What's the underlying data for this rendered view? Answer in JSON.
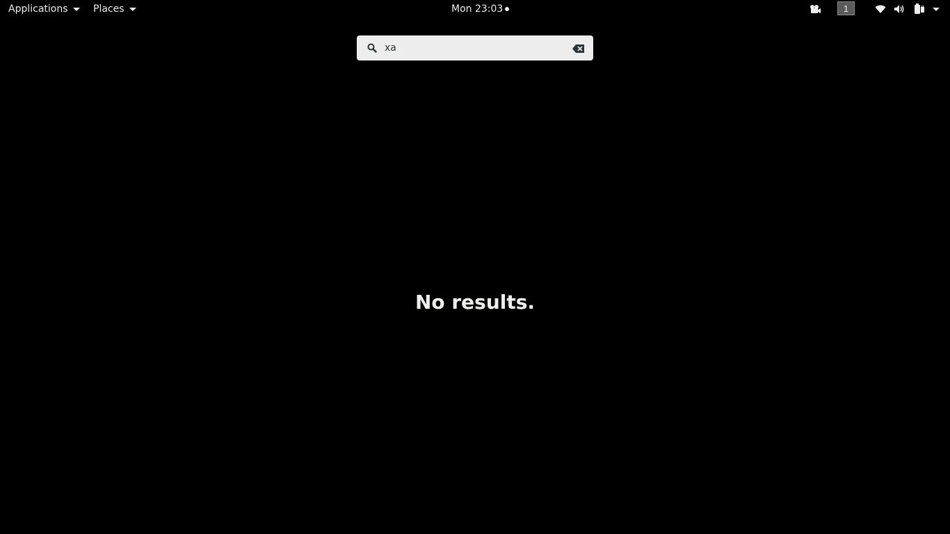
{
  "topbar": {
    "applications_label": "Applications",
    "places_label": "Places",
    "clock": "Mon 23:03",
    "workspace_number": "1",
    "tray_icons": [
      "camera-icon",
      "wifi-icon",
      "volume-icon",
      "battery-icon",
      "chevron-down-icon"
    ]
  },
  "search": {
    "value": "xa",
    "icon": "search-icon",
    "clear_icon": "clear-icon"
  },
  "main": {
    "message": "No results."
  },
  "colors": {
    "background": "#000000",
    "text": "#eeeeec",
    "search_bg": "#ededed"
  }
}
